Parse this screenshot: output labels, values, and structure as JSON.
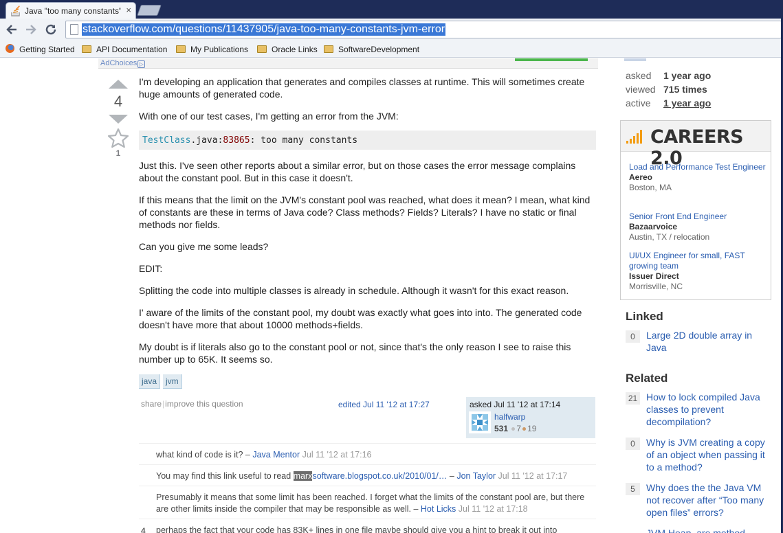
{
  "browser": {
    "tab_title": "Java \"too many constants\"",
    "tab_close": "×",
    "url": "stackoverflow.com/questions/11437905/java-too-many-constants-jvm-error",
    "back_icon": "arrow-left",
    "forward_icon": "arrow-right",
    "reload_icon": "reload",
    "bookmarks": [
      "Getting Started",
      "API Documentation",
      "My Publications",
      "Oracle Links",
      "SoftwareDevelopment"
    ]
  },
  "ad": {
    "adchoices": "AdChoices"
  },
  "vote": {
    "count": "4",
    "favorites": "1"
  },
  "question": {
    "p1": "I'm developing an application that generates and compiles classes at runtime. This will sometimes create huge amounts of generated code.",
    "p2": "With one of our test cases, I'm getting an error from the JVM:",
    "code_type": "TestClass",
    "code_mid": ".java:",
    "code_num": "83865",
    "code_rest": ": too many constants",
    "p3": "Just this. I've seen other reports about a similar error, but on those cases the error message complains about the constant pool. But in this case it doesn't.",
    "p4": "If this means that the limit on the JVM's constant pool was reached, what does it mean? I mean, what kind of constants are these in terms of Java code? Class methods? Fields? Literals? I have no static or final methods nor fields.",
    "p5": "Can you give me some leads?",
    "p6": "EDIT:",
    "p7": "Splitting the code into multiple classes is already in schedule. Although it wasn't for this exact reason.",
    "p8": "I' aware of the limits of the constant pool, my doubt was exactly what goes into into. The generated code doesn't have more that about 10000 methods+fields.",
    "p9": "My doubt is if literals also go to the constant pool or not, since that's the only reason I see to raise this number up to 65K. It seems so."
  },
  "tags": [
    "java",
    "jvm"
  ],
  "post_menu": {
    "share": "share",
    "improve": "improve this question",
    "separator": "|"
  },
  "edited": "edited Jul 11 '12 at 17:27",
  "owner": {
    "asked": "asked Jul 11 '12 at 17:14",
    "name": "halfwarp",
    "rep": "531",
    "silver": "7",
    "bronze": "19"
  },
  "comments": [
    {
      "score": "",
      "text": "what kind of code is it? – ",
      "user": "Java Mentor",
      "date": "Jul 11 '12 at 17:16"
    },
    {
      "score": "",
      "text_pre": "You may find this link useful to read ",
      "highlight": "marx",
      "link": "software.blogspot.co.uk/2010/01/…",
      "dash": " – ",
      "user": "Jon Taylor",
      "date": "Jul 11 '12 at 17:17"
    },
    {
      "score": "",
      "text": "Presumably it means that some limit has been reached. I forget what the limits of the constant pool are, but there are other limits inside the compiler that may be responsible as well. – ",
      "user": "Hot Licks",
      "date": "Jul 11 '12 at 17:18"
    },
    {
      "score": "4",
      "text": "perhaps the fact that your code has 83K+ lines in one file maybe should give you a hint to break it out into"
    }
  ],
  "stats": {
    "asked_label": "asked",
    "asked_value": "1 year ago",
    "viewed_label": "viewed",
    "viewed_value": "715 times",
    "active_label": "active",
    "active_value": "1 year ago"
  },
  "careers": {
    "title": "CAREERS 2.0",
    "jobs": [
      {
        "title": "Load and Performance Test Engineer",
        "company": "Aereo",
        "location": "Boston, MA"
      },
      {
        "title": "Senior Front End Engineer",
        "company": "Bazaarvoice",
        "location": "Austin, TX / relocation"
      },
      {
        "title": "UI/UX Engineer for small, FAST growing team",
        "company": "Issuer Direct",
        "location": "Morrisville, NC"
      }
    ]
  },
  "linked": {
    "heading": "Linked",
    "items": [
      {
        "score": "0",
        "title": "Large 2D double array in Java"
      }
    ]
  },
  "related": {
    "heading": "Related",
    "items": [
      {
        "score": "21",
        "title": "How to lock compiled Java classes to prevent decompilation?"
      },
      {
        "score": "0",
        "title": "Why is JVM creating a copy of an object when passing it to a method?"
      },
      {
        "score": "5",
        "title": "Why does the the Java VM not recover after “Too many open files” errors?"
      },
      {
        "score": "",
        "title": "JVM Heap, are method"
      }
    ]
  },
  "colors": {
    "link": "#2a5db0",
    "tag_bg": "#e0eaf1",
    "careers_bars": "#f39c12",
    "url_highlight": "#3a78d6"
  }
}
